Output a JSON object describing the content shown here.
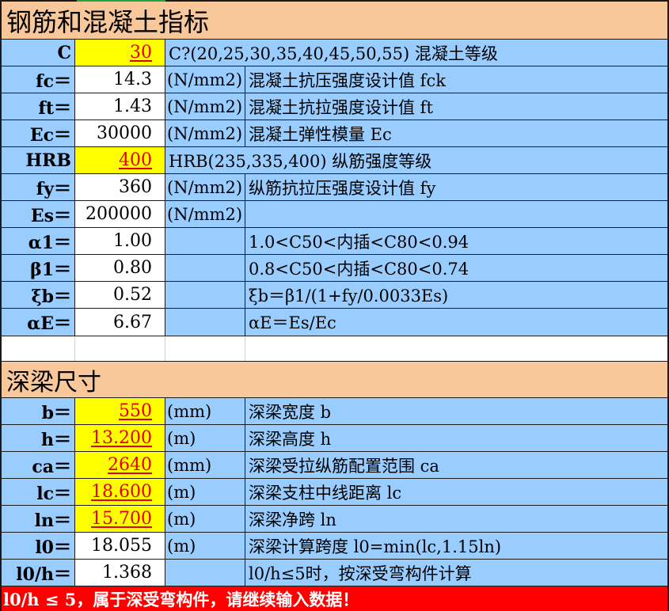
{
  "section1": {
    "title": "钢筋和混凝土指标"
  },
  "rows1": [
    {
      "label": "C",
      "value": "30",
      "unit": "C?(20,25,30,35,40,45,50,55) 混凝土等级",
      "desc": ""
    },
    {
      "label": "fc＝",
      "value": "14.3",
      "unit": "(N/mm2)",
      "desc": "混凝土抗压强度设计值 fck"
    },
    {
      "label": "ft＝",
      "value": "1.43",
      "unit": "(N/mm2)",
      "desc": "混凝土抗拉强度设计值 ft"
    },
    {
      "label": "Ec＝",
      "value": "30000",
      "unit": "(N/mm2)",
      "desc": "混凝土弹性模量 Ec"
    },
    {
      "label": "HRB",
      "value": "400",
      "unit": "HRB(235,335,400) 纵筋强度等级",
      "desc": ""
    },
    {
      "label": "fy＝",
      "value": "360",
      "unit": "(N/mm2)",
      "desc": "纵筋抗拉压强度设计值 fy"
    },
    {
      "label": "Es＝",
      "value": "200000",
      "unit": "(N/mm2)",
      "desc": ""
    },
    {
      "label": "α1＝",
      "value": "1.00",
      "unit": "",
      "desc": "1.0<C50<内插<C80<0.94"
    },
    {
      "label": "β1＝",
      "value": "0.80",
      "unit": "",
      "desc": "0.8<C50<内插<C80<0.74"
    },
    {
      "label": "ξb＝",
      "value": "0.52",
      "unit": "",
      "desc": " ξb＝β1/(1+fy/0.0033Es)"
    },
    {
      "label": "αE＝",
      "value": "6.67",
      "unit": "",
      "desc": " αE＝Es/Ec"
    }
  ],
  "section2": {
    "title": "深梁尺寸"
  },
  "rows2": [
    {
      "label": "b＝",
      "value": "550",
      "unit": "(mm)",
      "desc": "深梁宽度 b"
    },
    {
      "label": "h＝",
      "value": "13.200",
      "unit": "(m)",
      "desc": "深梁高度 h"
    },
    {
      "label": "ca＝",
      "value": "2640",
      "unit": "(mm)",
      "desc": "深梁受拉纵筋配置范围 ca"
    },
    {
      "label": "lc＝",
      "value": "18.600",
      "unit": "(m)",
      "desc": "深梁支柱中线距离 lc"
    },
    {
      "label": "ln＝",
      "value": "15.700",
      "unit": "(m)",
      "desc": "深梁净跨 ln"
    },
    {
      "label": "l0＝",
      "value": "18.055",
      "unit": "(m)",
      "desc": "深梁计算跨度 l0=min(lc,1.15ln)"
    },
    {
      "label": "l0/h＝",
      "value": "1.368",
      "unit": "",
      "desc": "l0/h≤5时，按深受弯构件计算"
    }
  ],
  "banner": {
    "text": "l0/h ≤ 5，属于深受弯构件，请继续输入数据！"
  },
  "colors": {
    "blue": "#99ccff",
    "yellow": "#ffff00",
    "peach": "#f8c89a",
    "red": "#ff0000",
    "input_text": "#e00000"
  }
}
